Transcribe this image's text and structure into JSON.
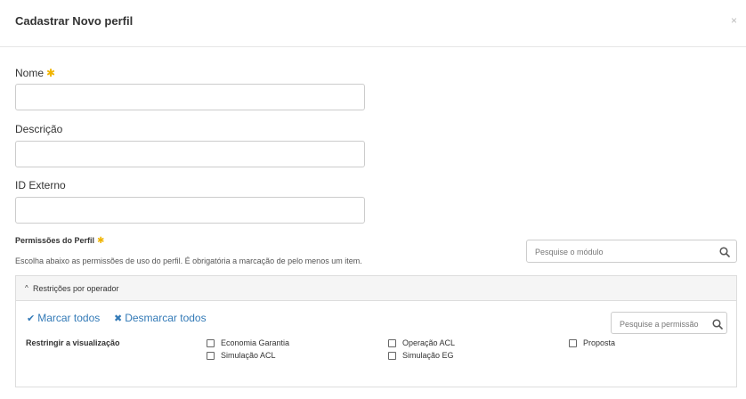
{
  "modal": {
    "title": "Cadastrar Novo perfil",
    "close_label": "×"
  },
  "form": {
    "name_label": "Nome",
    "description_label": "Descrição",
    "external_id_label": "ID Externo",
    "required_mark": "✱"
  },
  "permissions": {
    "title": "Permissões do Perfil",
    "description": "Escolha abaixo as permissões de uso do perfil. É obrigatória a marcação de pelo menos um item.",
    "module_search_placeholder": "Pesquise o módulo"
  },
  "panel": {
    "chevron": "^",
    "title": "Restrições por operador",
    "select_all_label": "Marcar todos",
    "deselect_all_label": "Desmarcar todos",
    "permission_search_placeholder": "Pesquise a permissão",
    "restrict_label": "Restringir a visualização",
    "options": [
      {
        "label": "Economia Garantia",
        "checked": false
      },
      {
        "label": "Operação ACL",
        "checked": false
      },
      {
        "label": "Proposta",
        "checked": false
      },
      {
        "label": "Simulação ACL",
        "checked": false
      },
      {
        "label": "Simulação EG",
        "checked": false
      }
    ]
  }
}
